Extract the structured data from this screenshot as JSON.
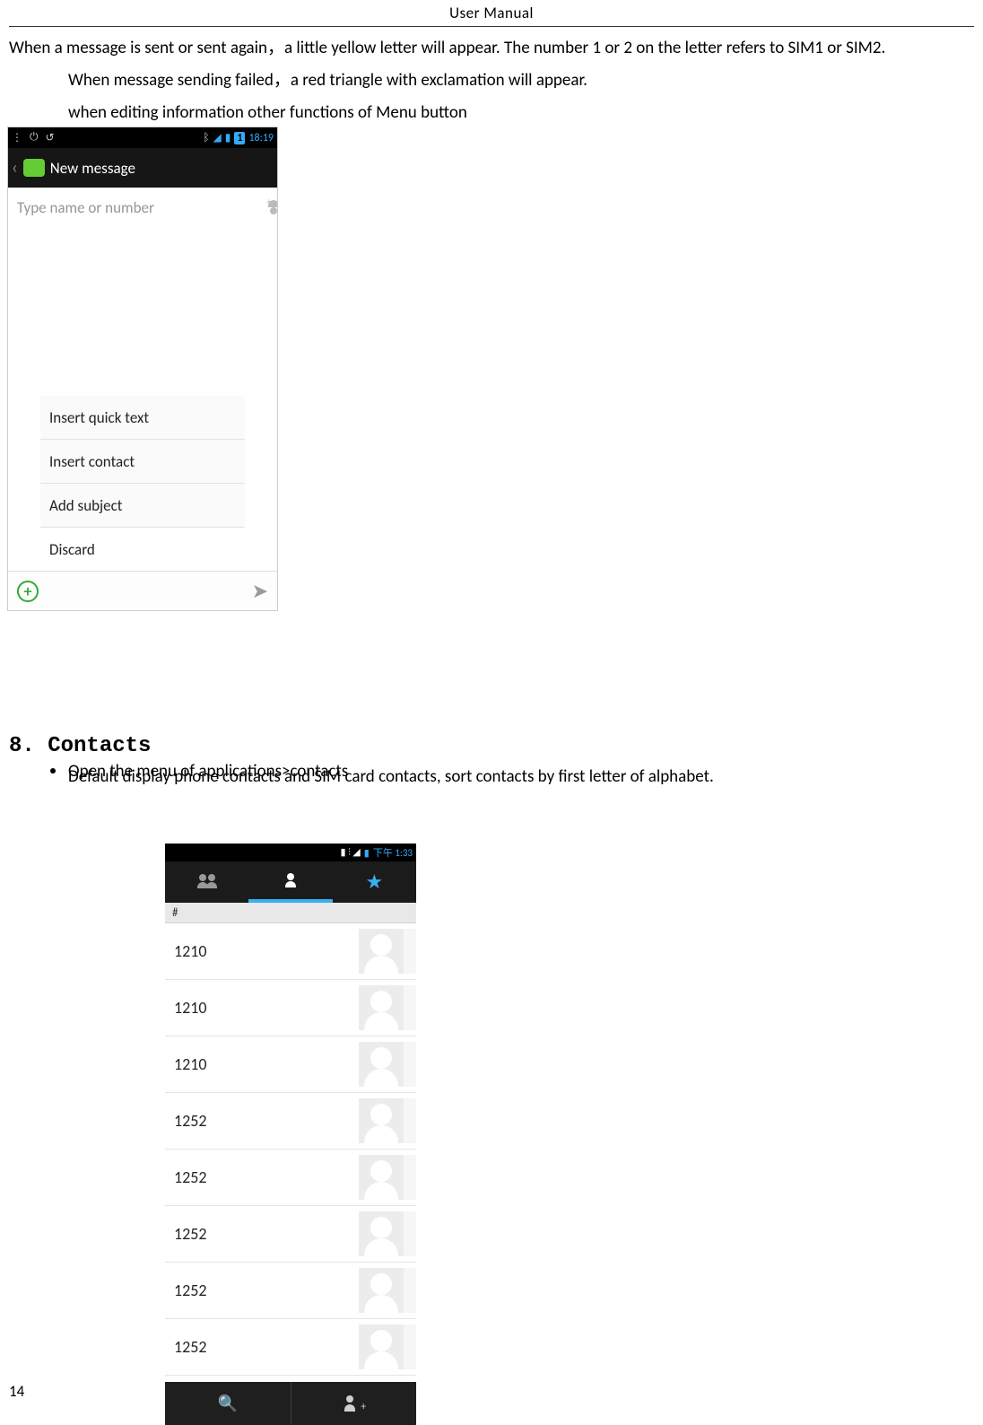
{
  "header": {
    "title": "User    Manual"
  },
  "page_number": "14",
  "text": {
    "p1": "When a message is sent or sent again，a little yellow letter will appear. The number 1 or 2 on the letter refers to SIM1 or SIM2.",
    "p2": "When message sending failed，a red triangle with exclamation will appear.",
    "p3": "when editing information other functions of Menu button",
    "section": "8. Contacts",
    "b1": "Open the menu of applications>contacts",
    "b2": "Default display phone contacts and SIM card contacts, sort contacts by first letter of alphabet."
  },
  "shot1": {
    "status": {
      "bt": "ᛒ",
      "wifi": "▾",
      "signal": "⫶",
      "sim": "1",
      "time": "18:19"
    },
    "topbar": {
      "title": "New message"
    },
    "input": {
      "placeholder": "Type name or number"
    },
    "menu": {
      "items": [
        "Insert quick text",
        "Insert contact",
        "Add subject",
        "Discard"
      ]
    }
  },
  "shot2": {
    "status": {
      "time": "下午 1:33"
    },
    "tabs": {
      "star": "★"
    },
    "section_label": "#",
    "contacts": [
      "1210",
      "1210",
      "1210",
      "1252",
      "1252",
      "1252",
      "1252",
      "1252"
    ]
  }
}
